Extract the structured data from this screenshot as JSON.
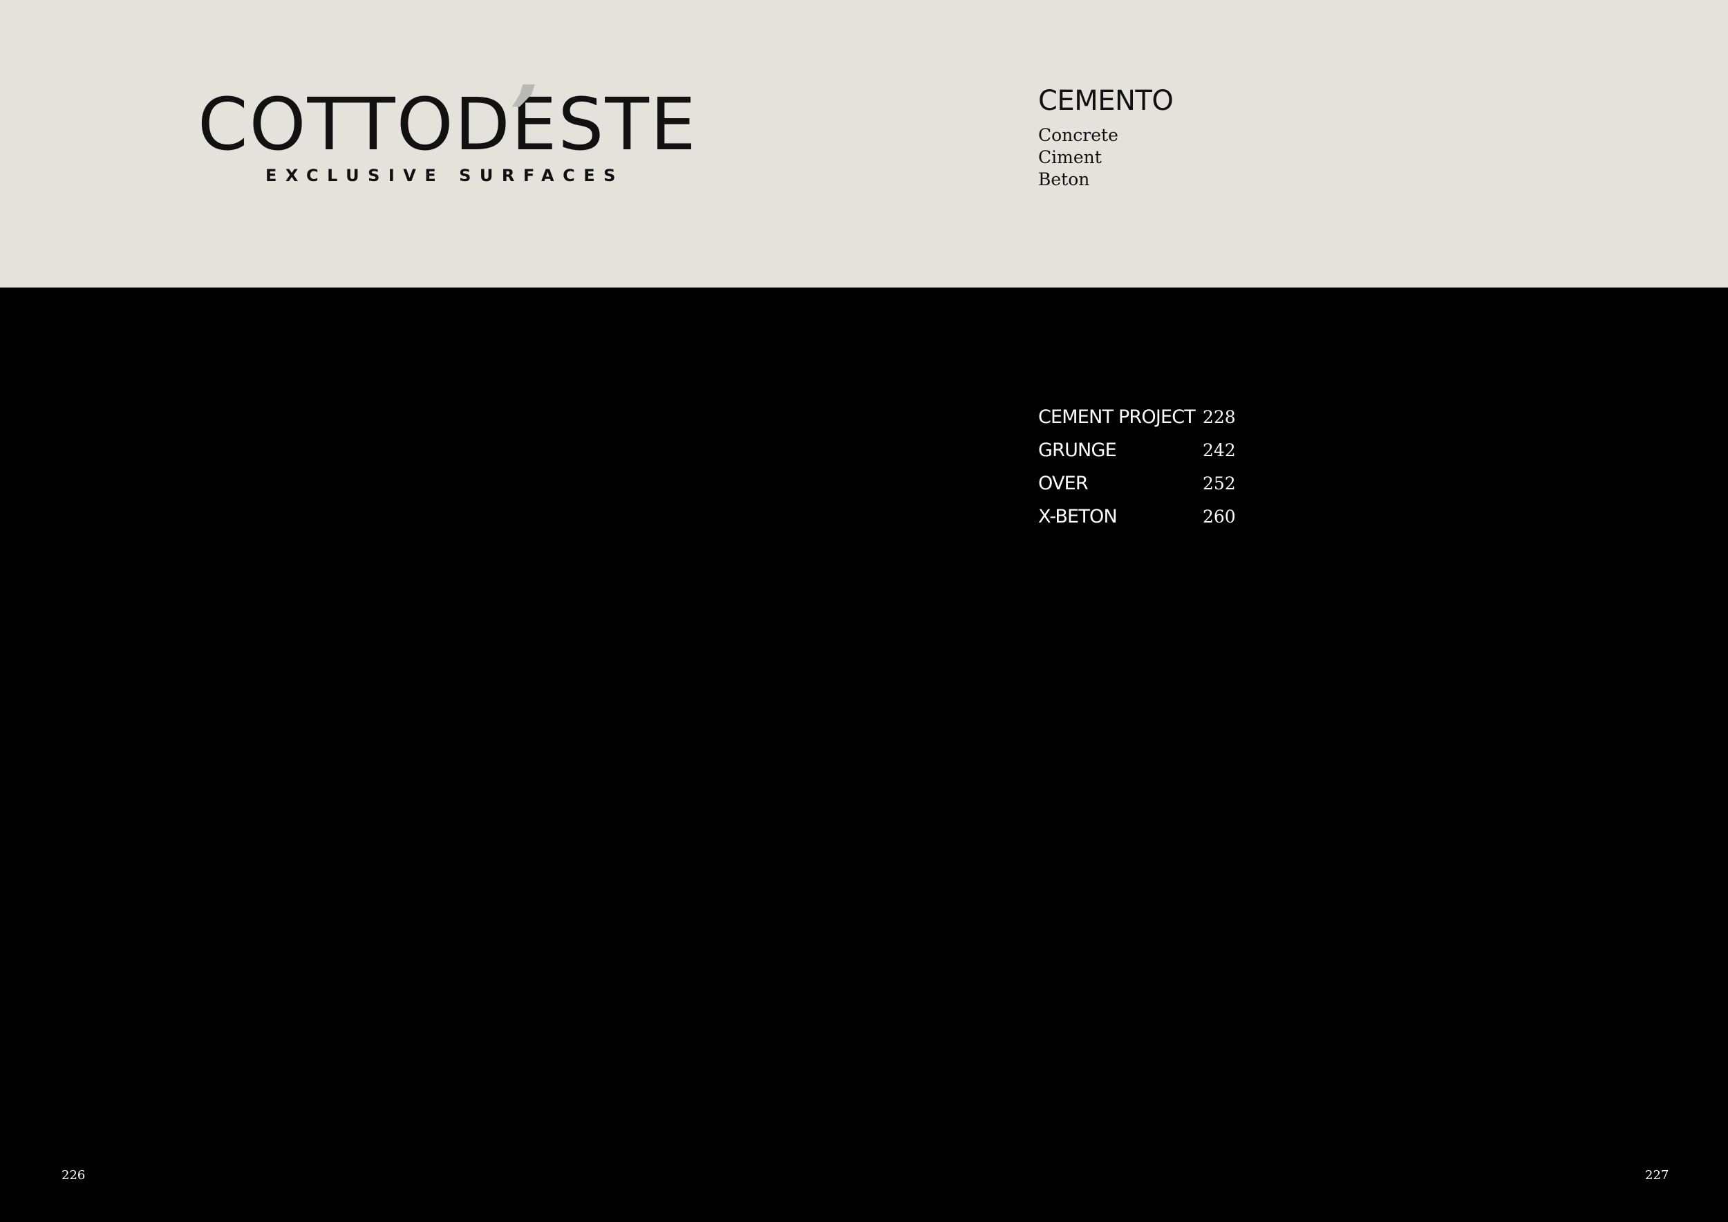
{
  "brand": {
    "wordmark_left": "COTTOD",
    "wordmark_accent": "’",
    "wordmark_right": "ESTE",
    "tagline": "EXCLUSIVE SURFACES"
  },
  "category": {
    "title": "CEMENTO",
    "translations": [
      "Concrete",
      "Ciment",
      "Beton"
    ]
  },
  "index": [
    {
      "name": "CEMENT PROJECT",
      "page": "228"
    },
    {
      "name": "GRUNGE",
      "page": "242"
    },
    {
      "name": "OVER",
      "page": "252"
    },
    {
      "name": "X-BETON",
      "page": "260"
    }
  ],
  "page_numbers": {
    "left": "226",
    "right": "227"
  },
  "colors": {
    "header_background": "#e4e2da",
    "body_background": "#000000",
    "accent_grey": "#b9b9b5"
  }
}
